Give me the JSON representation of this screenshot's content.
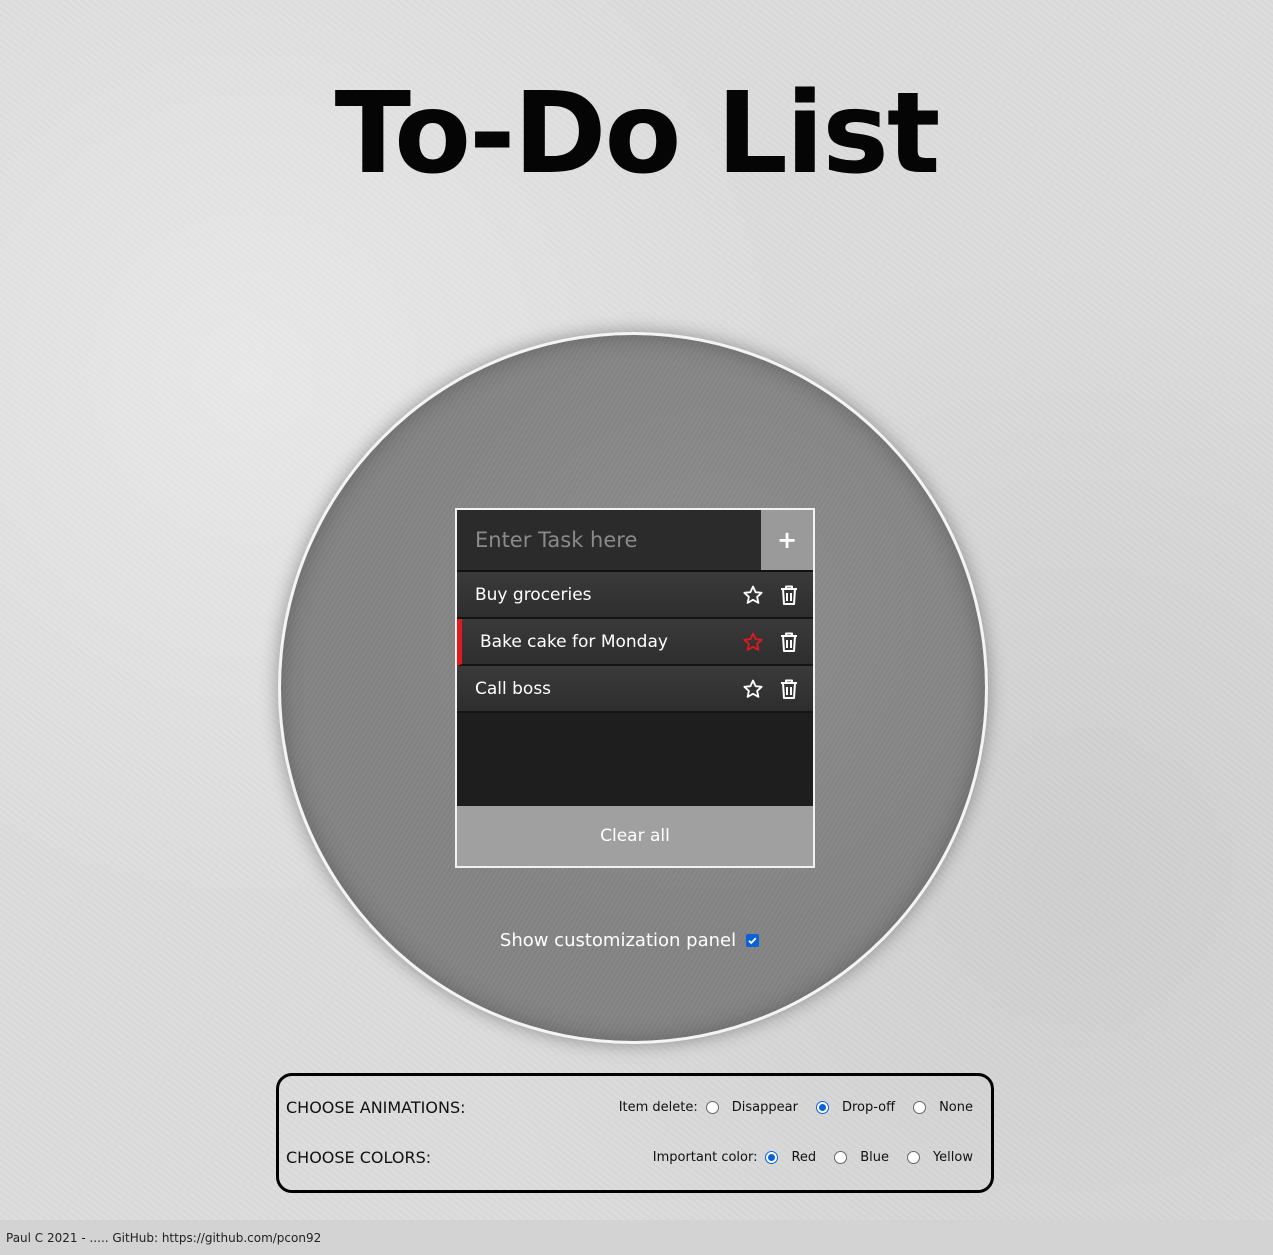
{
  "page": {
    "title": "To-Do List"
  },
  "todo": {
    "input": {
      "placeholder": "Enter Task here",
      "value": ""
    },
    "add_label": "+",
    "items": [
      {
        "text": "Buy groceries",
        "important": false
      },
      {
        "text": "Bake cake for Monday",
        "important": true
      },
      {
        "text": "Call boss",
        "important": false
      }
    ],
    "clear_label": "Clear all"
  },
  "customization": {
    "toggle_label": "Show customization panel",
    "toggle_checked": true,
    "animations": {
      "heading": "CHOOSE ANIMATIONS:",
      "group_label": "Item delete:",
      "options": [
        "Disappear",
        "Drop-off",
        "None"
      ],
      "selected": "Drop-off"
    },
    "colors": {
      "heading": "CHOOSE COLORS:",
      "group_label": "Important color:",
      "options": [
        "Red",
        "Blue",
        "Yellow"
      ],
      "selected": "Red"
    }
  },
  "footer": {
    "text": "Paul C 2021 - ..... GitHub: https://github.com/pcon92"
  },
  "colors": {
    "important_accent": "#e0191f",
    "checkbox_blue": "#0a62d8"
  },
  "icons": {
    "add": "plus-icon",
    "important": "star-icon",
    "delete": "trash-icon",
    "checkbox": "check-icon"
  }
}
